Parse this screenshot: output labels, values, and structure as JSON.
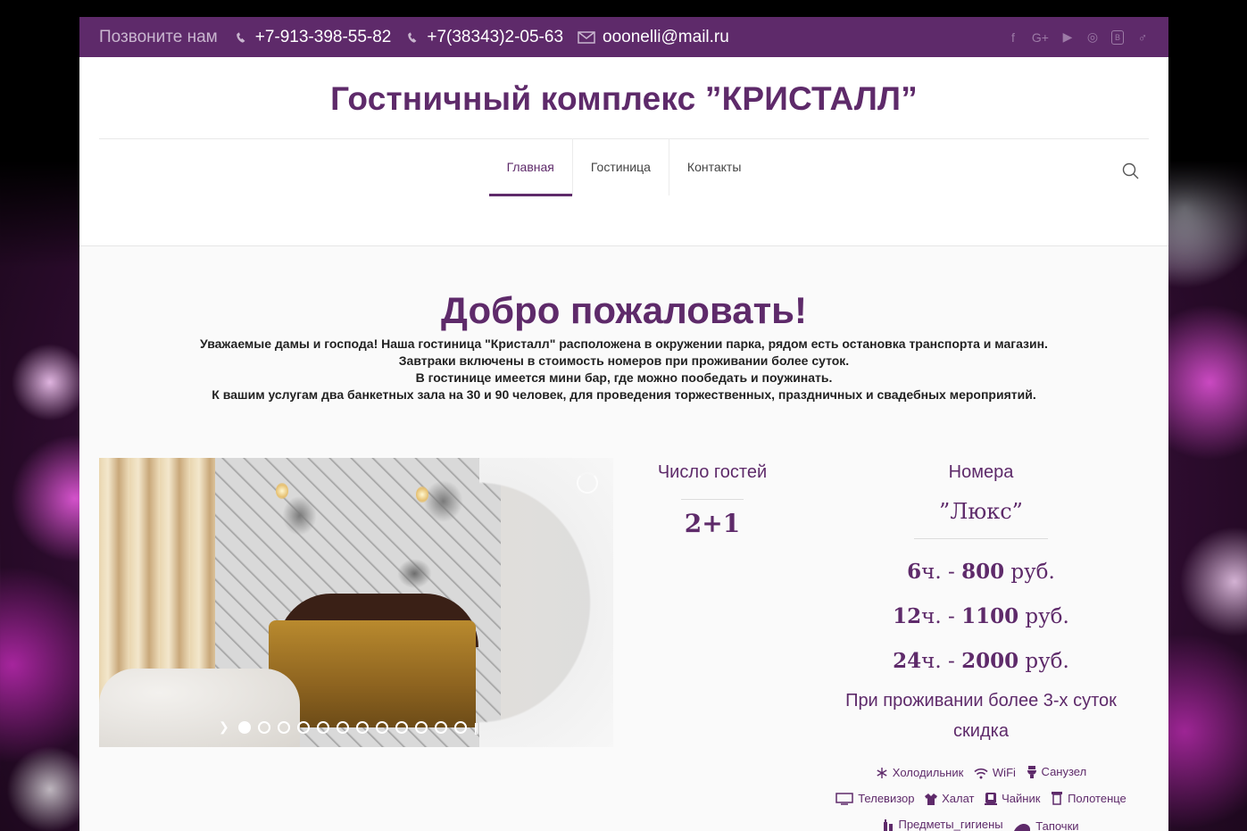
{
  "topbar": {
    "call_label": "Позвоните нам",
    "phone1": "+7-913-398-55-82",
    "phone2": "+7(38343)2-05-63",
    "email": "ooonelli@mail.ru",
    "socials": [
      {
        "name": "facebook-icon",
        "glyph": "f"
      },
      {
        "name": "google-plus-icon",
        "glyph": "G+"
      },
      {
        "name": "youtube-icon",
        "glyph": "▶"
      },
      {
        "name": "instagram-icon",
        "glyph": "◎"
      },
      {
        "name": "vk-icon",
        "glyph": "B"
      },
      {
        "name": "odnoklassniki-icon",
        "glyph": "♂"
      }
    ]
  },
  "header": {
    "title": "Гостничный комплекс ”КРИСТАЛЛ”",
    "nav": [
      {
        "label": "Главная",
        "active": true
      },
      {
        "label": "Гостиница",
        "active": false
      },
      {
        "label": "Контакты",
        "active": false
      }
    ]
  },
  "main": {
    "heading": "Добро пожаловать!",
    "intro_lines": [
      "Уважаемые дамы и господа! Наша гостиница \"Кристалл\" расположена в окружении парка, рядом есть остановка транспорта и магазин.",
      "Завтраки включены в стоимость номеров при проживании более суток.",
      "В гостинице имеется мини бар, где можно пообедать и поужинать.",
      "К вашим услугам два банкетных зала на 30 и 90 человек, для проведения торжественных, праздничных и свадебных мероприятий."
    ],
    "slider": {
      "dots": 12,
      "active_dot": 0
    },
    "guests": {
      "label": "Число гостей",
      "value": "2+1"
    },
    "rooms": {
      "label": "Номера",
      "name": "”Люкс”",
      "prices": [
        {
          "hours": "6",
          "suffix": "ч. -",
          "amount": "800",
          "currency": "руб."
        },
        {
          "hours": "12",
          "suffix": "ч. -",
          "amount": "1100",
          "currency": "руб."
        },
        {
          "hours": "24",
          "suffix": "ч. -",
          "amount": "2000",
          "currency": "руб."
        }
      ],
      "note": "При проживании более 3-х суток скидка"
    },
    "amenities": [
      {
        "label": "Холодильник",
        "icon": "snowflake-icon"
      },
      {
        "label": "WiFi",
        "icon": "wifi-icon"
      },
      {
        "label": "Санузел",
        "icon": "toilet-icon"
      },
      {
        "label": "Телевизор",
        "icon": "tv-icon"
      },
      {
        "label": "Халат",
        "icon": "robe-icon"
      },
      {
        "label": "Чайник",
        "icon": "kettle-icon"
      },
      {
        "label": "Полотенце",
        "icon": "towel-icon"
      },
      {
        "label": "Предметы_гигиены",
        "icon": "hygiene-icon"
      },
      {
        "label": "Тапочки",
        "icon": "slippers-icon"
      }
    ]
  },
  "colors": {
    "brand": "#5e2a6a",
    "topbar": "#5e2a6a",
    "text": "#222222"
  }
}
